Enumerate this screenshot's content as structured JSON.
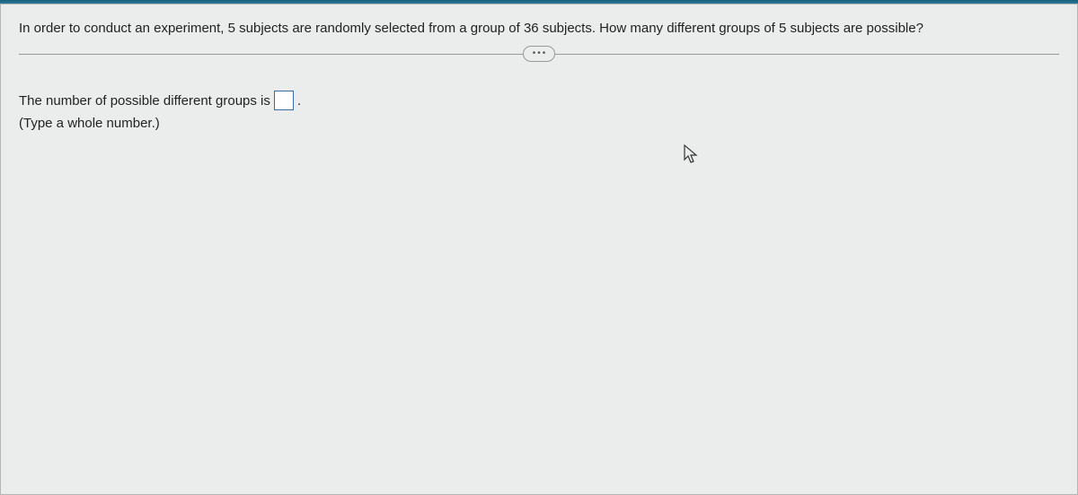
{
  "question": {
    "prompt": "In order to conduct an experiment, 5 subjects are randomly selected from a group of 36 subjects. How many different groups of 5 subjects are possible?"
  },
  "answer": {
    "prefix": "The number of possible different groups is",
    "suffix": ".",
    "input_value": "",
    "hint": "(Type a whole number.)"
  },
  "divider": {
    "ellipsis": "•••"
  }
}
